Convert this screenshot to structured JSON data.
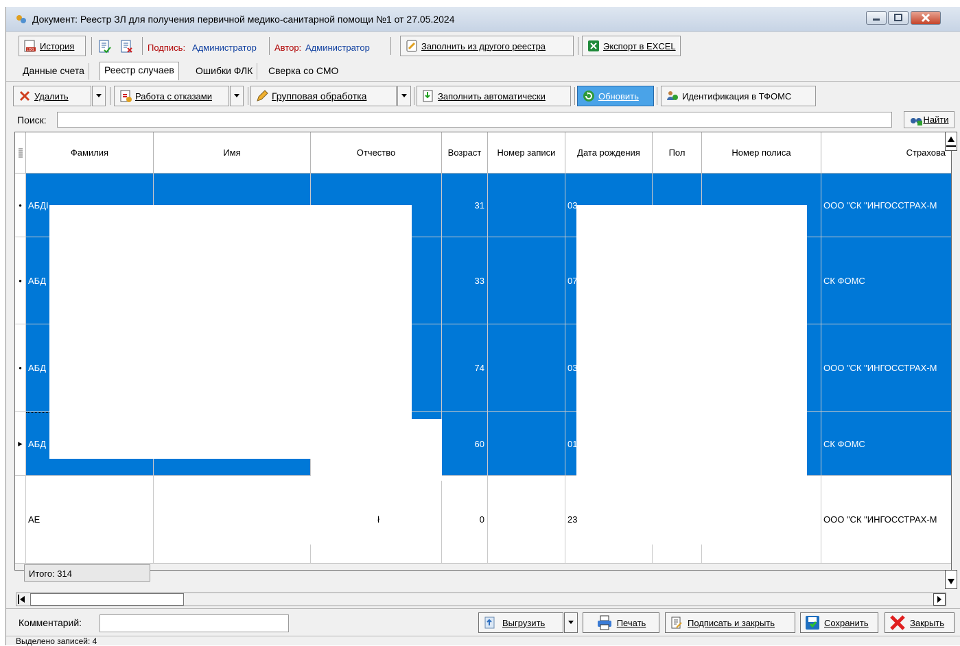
{
  "window": {
    "title": "Документ: Реестр ЗЛ для получения первичной медико-санитарной помощи №1 от 27.05.2024"
  },
  "toolbar1": {
    "history": "История",
    "sign_label": "Подпись:",
    "sign_value": "Администратор",
    "author_label": "Автор:",
    "author_value": "Администратор",
    "fill_other": "Заполнить из другого реестра",
    "export_excel": "Экспорт в EXCEL"
  },
  "tabs": [
    "Данные счета",
    "Реестр случаев",
    "Ошибки ФЛК",
    "Сверка со СМО"
  ],
  "toolbar2": {
    "delete": "Удалить",
    "refusals": "Работа с отказами",
    "group": "Групповая обработка",
    "autofill": "Заполнить автоматически",
    "refresh": "Обновить",
    "identify": "Идентификация в ТФОМС"
  },
  "search": {
    "label": "Поиск:",
    "button": "Найти",
    "value": ""
  },
  "grid": {
    "columns": [
      "Фамилия",
      "Имя",
      "Отчество",
      "Возраст",
      "Номер записи",
      "Дата рождения",
      "Пол",
      "Номер полиса",
      "Страхова"
    ],
    "rows": [
      {
        "marker": "•",
        "surname": "АБДІ",
        "age": "31",
        "birth": "03",
        "insurer": "ООО \"СК \"ИНГОССТРАХ-М"
      },
      {
        "marker": "•",
        "surname": "АБД",
        "age": "33",
        "birth": "07",
        "insurer": "СК ФОМС"
      },
      {
        "marker": "•",
        "surname": "АБД",
        "age": "74",
        "birth": "03",
        "insurer": "ООО \"СК \"ИНГОССТРАХ-М"
      },
      {
        "marker": "▸",
        "surname": "АБД",
        "age": "60",
        "birth": "01",
        "insurer": "СК ФОМС"
      },
      {
        "marker": "",
        "surname": "АЕ",
        "patronymic": "ł",
        "age": "0",
        "birth": "23",
        "insurer": "ООО \"СК \"ИНГОССТРАХ-М"
      }
    ],
    "total": "Итого: 314"
  },
  "bottom": {
    "comment_label": "Комментарий:",
    "comment_value": "",
    "upload": "Выгрузить",
    "print": "Печать",
    "sign_close": "Подписать и закрыть",
    "save": "Сохранить",
    "close": "Закрыть"
  },
  "status": {
    "selected": "Выделено записей: 4"
  },
  "colors": {
    "selection": "#0078d7",
    "sign_red": "#b00000",
    "author_blue": "#1040a0"
  }
}
